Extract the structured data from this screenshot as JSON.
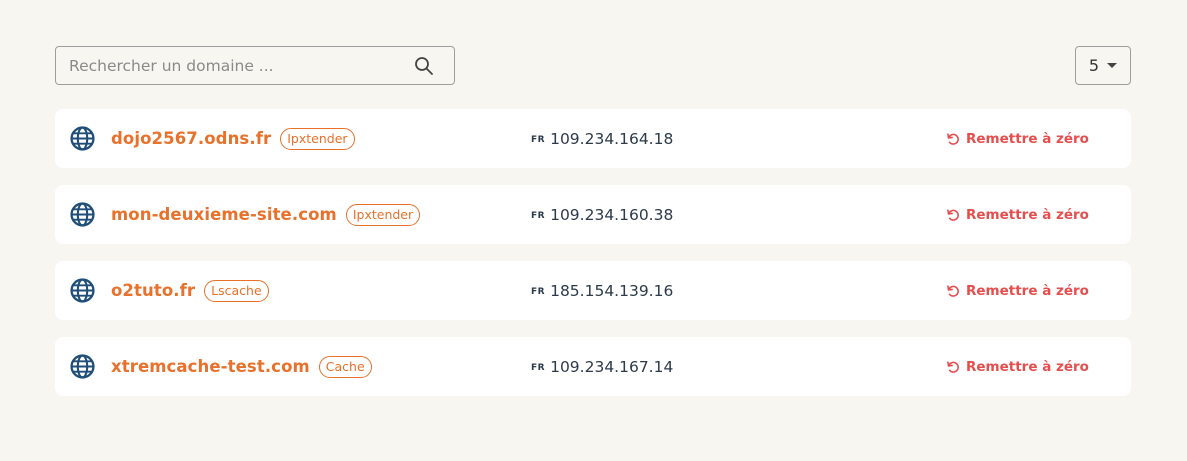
{
  "search": {
    "placeholder": "Rechercher un domaine ..."
  },
  "pagination": {
    "per_page": "5"
  },
  "colors": {
    "accent": "#e8712b",
    "reset": "#e64d4d",
    "text": "#2d3a4a",
    "globe": "#1f4e79"
  },
  "domains": [
    {
      "name": "dojo2567.odns.fr",
      "badge": "Ipxtender",
      "country": "FR",
      "ip": "109.234.164.18",
      "action": "Remettre à zéro",
      "icon": "globe-icon"
    },
    {
      "name": "mon-deuxieme-site.com",
      "badge": "Ipxtender",
      "country": "FR",
      "ip": "109.234.160.38",
      "action": "Remettre à zéro",
      "icon": "globe-icon"
    },
    {
      "name": "o2tuto.fr",
      "badge": "Lscache",
      "country": "FR",
      "ip": "185.154.139.16",
      "action": "Remettre à zéro",
      "icon": "globe-icon"
    },
    {
      "name": "xtremcache-test.com",
      "badge": "Cache",
      "country": "FR",
      "ip": "109.234.167.14",
      "action": "Remettre à zéro",
      "icon": "globe-icon"
    }
  ]
}
